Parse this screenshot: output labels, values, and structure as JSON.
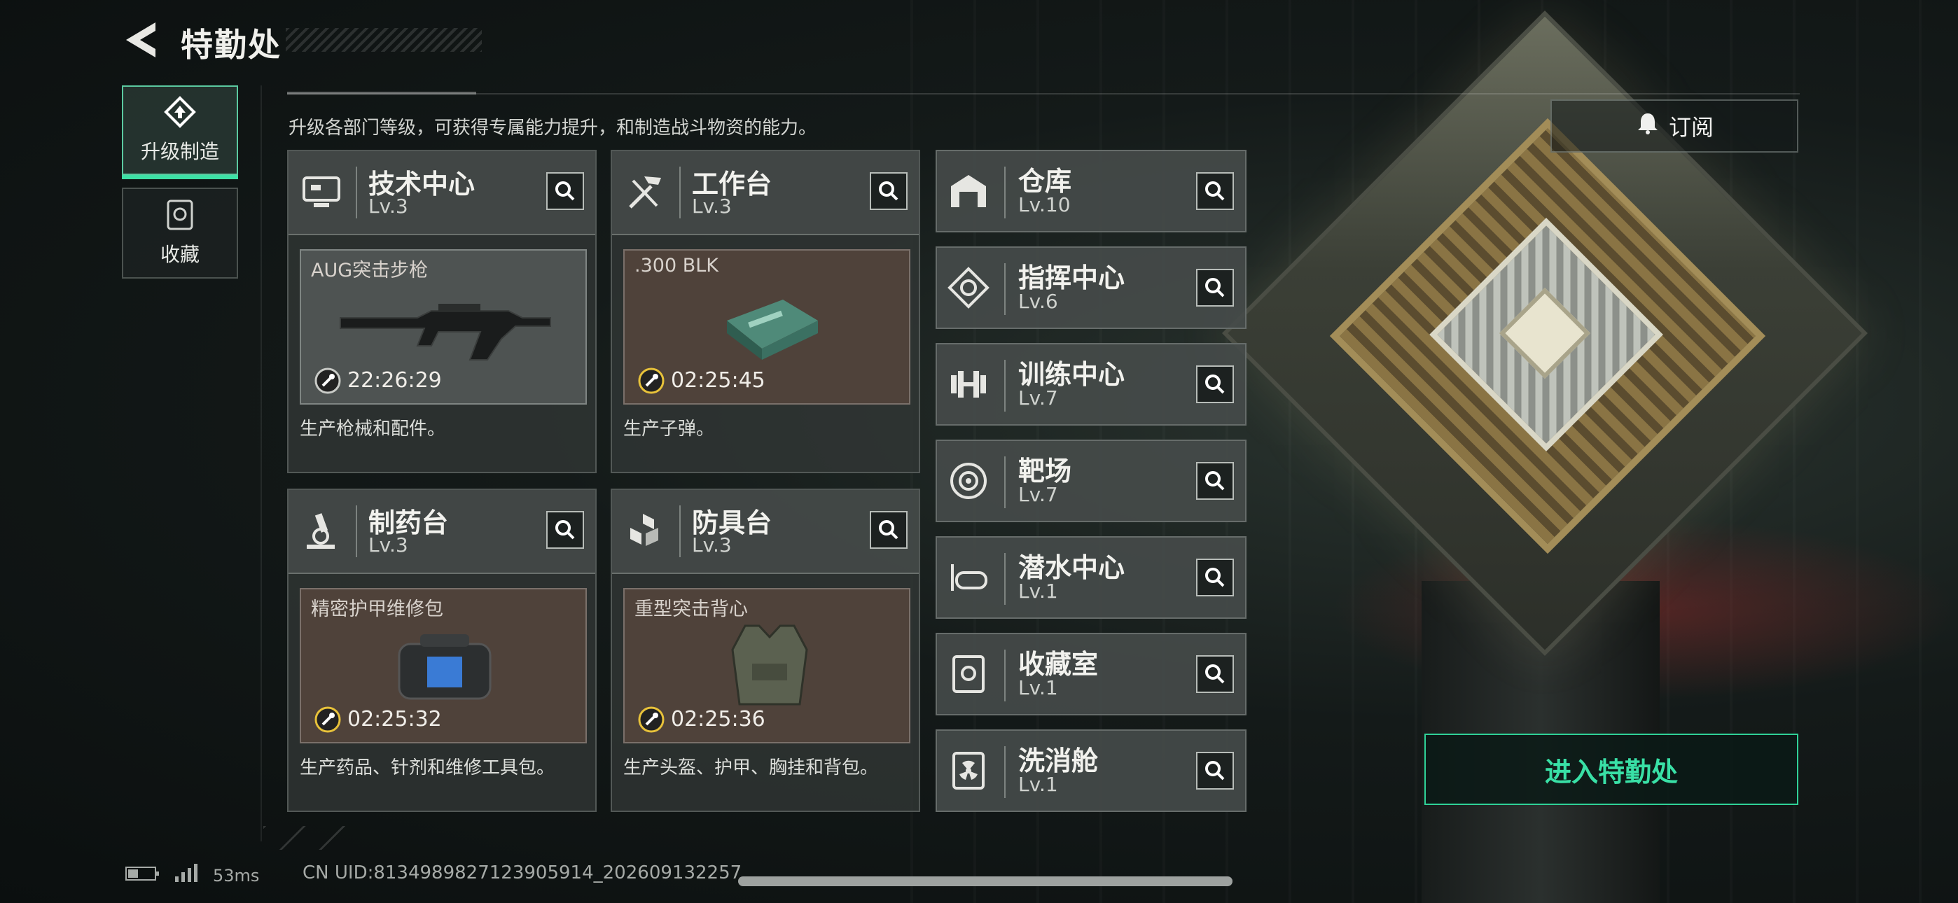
{
  "header": {
    "title": "特勤处"
  },
  "subtitle": "升级各部门等级，可获得专属能力提升，和制造战斗物资的能力。",
  "tabs": [
    {
      "label": "升级制造",
      "active": true
    },
    {
      "label": "收藏",
      "active": false
    }
  ],
  "cards": [
    {
      "name": "技术中心",
      "level": "Lv.3",
      "item": "AUG突击步枪",
      "timer": "22:26:29",
      "desc": "生产枪械和配件。"
    },
    {
      "name": "工作台",
      "level": "Lv.3",
      "item": ".300 BLK",
      "timer": "02:25:45",
      "desc": "生产子弹。"
    },
    {
      "name": "制药台",
      "level": "Lv.3",
      "item": "精密护甲维修包",
      "timer": "02:25:32",
      "desc": "生产药品、针剂和维修工具包。"
    },
    {
      "name": "防具台",
      "level": "Lv.3",
      "item": "重型突击背心",
      "timer": "02:25:36",
      "desc": "生产头盔、护甲、胸挂和背包。"
    }
  ],
  "facilities": [
    {
      "name": "仓库",
      "level": "Lv.10"
    },
    {
      "name": "指挥中心",
      "level": "Lv.6"
    },
    {
      "name": "训练中心",
      "level": "Lv.7"
    },
    {
      "name": "靶场",
      "level": "Lv.7"
    },
    {
      "name": "潜水中心",
      "level": "Lv.1"
    },
    {
      "name": "收藏室",
      "level": "Lv.1"
    },
    {
      "name": "洗消舱",
      "level": "Lv.1"
    }
  ],
  "buttons": {
    "subscribe": "订阅",
    "enter": "进入特勤处"
  },
  "status": {
    "ping": "53ms",
    "uid": "CN UID:8134989827123905914_202609132257"
  },
  "colors": {
    "accent": "#3ee0a5",
    "panel": "#323736",
    "product_bg": "#4f423a"
  },
  "icons": [
    "back-arrow-icon",
    "upgrade-icon",
    "collection-icon",
    "computer-icon",
    "tools-icon",
    "microscope-icon",
    "armor-parts-icon",
    "warehouse-icon",
    "command-icon",
    "dumbbell-icon",
    "target-icon",
    "diving-mask-icon",
    "vault-icon",
    "radiation-icon",
    "search-icon",
    "bell-icon",
    "wrench-clock-icon",
    "battery-icon",
    "signal-icon"
  ]
}
